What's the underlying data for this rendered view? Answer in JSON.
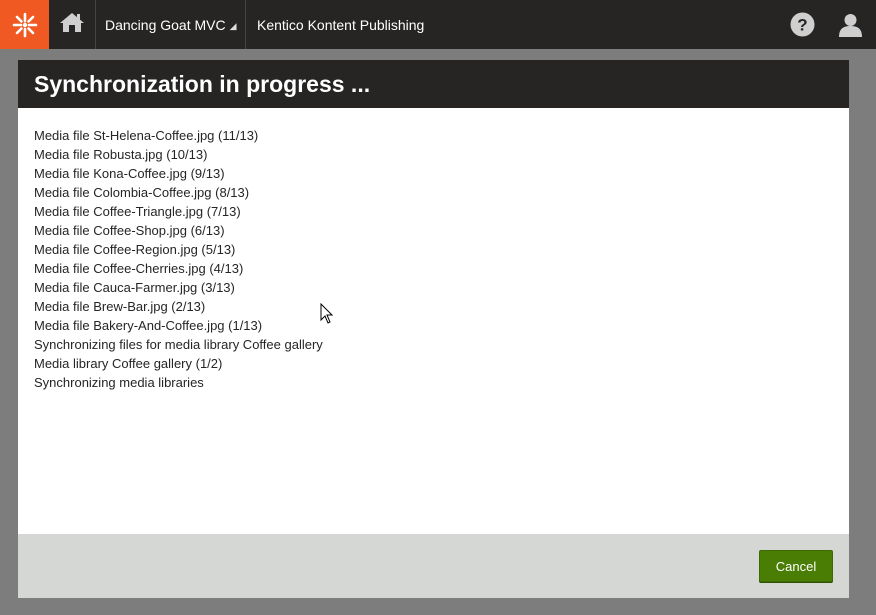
{
  "topbar": {
    "logo_icon": "kentico-logo-icon",
    "home_icon": "home-icon",
    "site_name": "Dancing Goat MVC",
    "site_caret": "◢",
    "app_name": "Kentico Kontent Publishing",
    "help_icon": "help-icon",
    "user_icon": "user-icon"
  },
  "modal": {
    "title": "Synchronization in progress ...",
    "log": [
      "Media file St-Helena-Coffee.jpg (11/13)",
      "Media file Robusta.jpg (10/13)",
      "Media file Kona-Coffee.jpg (9/13)",
      "Media file Colombia-Coffee.jpg (8/13)",
      "Media file Coffee-Triangle.jpg (7/13)",
      "Media file Coffee-Shop.jpg (6/13)",
      "Media file Coffee-Region.jpg (5/13)",
      "Media file Coffee-Cherries.jpg (4/13)",
      "Media file Cauca-Farmer.jpg (3/13)",
      "Media file Brew-Bar.jpg (2/13)",
      "Media file Bakery-And-Coffee.jpg (1/13)",
      "Synchronizing files for media library Coffee gallery",
      "Media library Coffee gallery (1/2)",
      "Synchronizing media libraries"
    ],
    "cancel_label": "Cancel"
  },
  "colors": {
    "brand_orange": "#f05a22",
    "header_dark": "#262524",
    "button_green": "#497d04",
    "footer_gray": "#d5d7d4"
  }
}
